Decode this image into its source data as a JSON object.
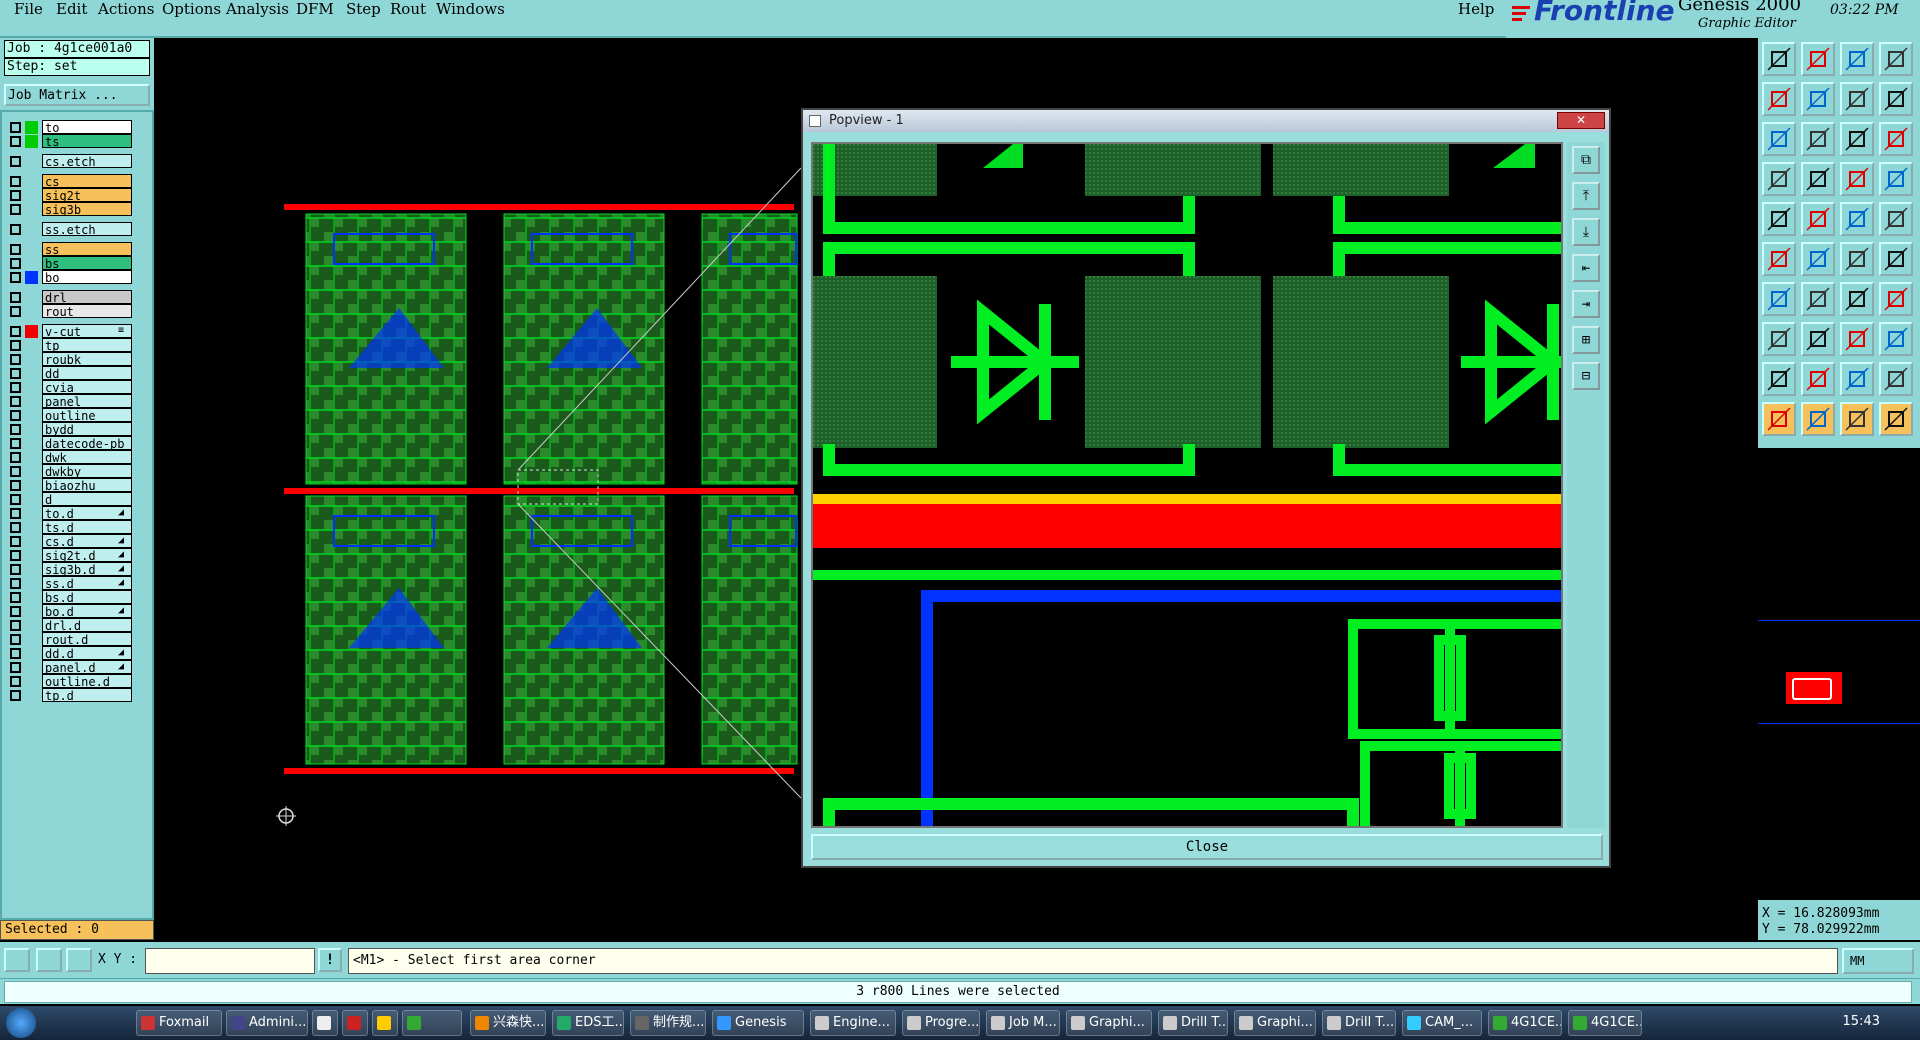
{
  "menubar": {
    "items": [
      "File",
      "Edit",
      "Actions",
      "Options",
      "Analysis",
      "DFM",
      "Step",
      "Rout",
      "Windows"
    ],
    "help": "Help"
  },
  "brand": {
    "logo": "Frontline",
    "product": "Genesis 2000",
    "subtitle": "Graphic Editor",
    "time": "03:22 PM"
  },
  "job": {
    "job_line": "Job : 4g1ce001a0",
    "step_line": "Step: set",
    "matrix_button": "Job Matrix ..."
  },
  "layers": [
    {
      "name": "to",
      "color": "#00cc00",
      "bg": "#ffffff",
      "flag": ""
    },
    {
      "name": "ts",
      "color": "#00cc00",
      "bg": "#2fbf7f",
      "flag": ""
    },
    {
      "name": "cs.etch",
      "color": "",
      "bg": "#bfeeee",
      "flag": ""
    },
    {
      "name": "cs",
      "color": "",
      "bg": "#f6c05a",
      "flag": ""
    },
    {
      "name": "sig2t",
      "color": "",
      "bg": "#f6c05a",
      "flag": ""
    },
    {
      "name": "sig3b",
      "color": "",
      "bg": "#f6c05a",
      "flag": ""
    },
    {
      "name": "ss.etch",
      "color": "",
      "bg": "#bfeeee",
      "flag": ""
    },
    {
      "name": "ss",
      "color": "",
      "bg": "#f6c05a",
      "flag": ""
    },
    {
      "name": "bs",
      "color": "",
      "bg": "#2fbf7f",
      "flag": ""
    },
    {
      "name": "bo",
      "color": "#0033ff",
      "bg": "#ffffff",
      "flag": ""
    },
    {
      "name": "drl",
      "color": "",
      "bg": "#c8c8c8",
      "flag": ""
    },
    {
      "name": "rout",
      "color": "",
      "bg": "#e8e8e8",
      "flag": ""
    },
    {
      "name": "v-cut",
      "color": "#ee0000",
      "bg": "#bfeeee",
      "flag": "≡"
    },
    {
      "name": "tp",
      "color": "",
      "bg": "#bfeeee",
      "flag": ""
    },
    {
      "name": "roubk",
      "color": "",
      "bg": "#bfeeee",
      "flag": ""
    },
    {
      "name": "dd",
      "color": "",
      "bg": "#bfeeee",
      "flag": ""
    },
    {
      "name": "cvia",
      "color": "",
      "bg": "#bfeeee",
      "flag": ""
    },
    {
      "name": "panel",
      "color": "",
      "bg": "#bfeeee",
      "flag": ""
    },
    {
      "name": "outline",
      "color": "",
      "bg": "#bfeeee",
      "flag": ""
    },
    {
      "name": "bydd",
      "color": "",
      "bg": "#bfeeee",
      "flag": ""
    },
    {
      "name": "datecode-pb",
      "color": "",
      "bg": "#bfeeee",
      "flag": ""
    },
    {
      "name": "dwk",
      "color": "",
      "bg": "#bfeeee",
      "flag": ""
    },
    {
      "name": "dwkby",
      "color": "",
      "bg": "#bfeeee",
      "flag": ""
    },
    {
      "name": "biaozhu",
      "color": "",
      "bg": "#bfeeee",
      "flag": ""
    },
    {
      "name": "d",
      "color": "",
      "bg": "#bfeeee",
      "flag": ""
    },
    {
      "name": "to.d",
      "color": "",
      "bg": "#bfeeee",
      "flag": "◢"
    },
    {
      "name": "ts.d",
      "color": "",
      "bg": "#bfeeee",
      "flag": ""
    },
    {
      "name": "cs.d",
      "color": "",
      "bg": "#bfeeee",
      "flag": "◢"
    },
    {
      "name": "sig2t.d",
      "color": "",
      "bg": "#bfeeee",
      "flag": "◢"
    },
    {
      "name": "sig3b.d",
      "color": "",
      "bg": "#bfeeee",
      "flag": "◢"
    },
    {
      "name": "ss.d",
      "color": "",
      "bg": "#bfeeee",
      "flag": "◢"
    },
    {
      "name": "bs.d",
      "color": "",
      "bg": "#bfeeee",
      "flag": ""
    },
    {
      "name": "bo.d",
      "color": "",
      "bg": "#bfeeee",
      "flag": "◢"
    },
    {
      "name": "drl.d",
      "color": "",
      "bg": "#bfeeee",
      "flag": ""
    },
    {
      "name": "rout.d",
      "color": "",
      "bg": "#bfeeee",
      "flag": ""
    },
    {
      "name": "dd.d",
      "color": "",
      "bg": "#bfeeee",
      "flag": "◢"
    },
    {
      "name": "panel.d",
      "color": "",
      "bg": "#bfeeee",
      "flag": "◢"
    },
    {
      "name": "outline.d",
      "color": "",
      "bg": "#bfeeee",
      "flag": ""
    },
    {
      "name": "tp.d",
      "color": "",
      "bg": "#bfeeee",
      "flag": ""
    }
  ],
  "selected": "Selected : 0",
  "popview": {
    "title": "Popview - 1",
    "close_label": "Close"
  },
  "coords": {
    "x": "X = 16.828093mm",
    "y": "Y = 78.029922mm"
  },
  "command": {
    "xy_label": "X Y :",
    "xy_value": "",
    "message": "<M1> - Select first area corner",
    "units": "MM"
  },
  "status": "3 r800 Lines were selected",
  "taskbar": {
    "items": [
      "Foxmail",
      "Admini...",
      "",
      "",
      "",
      "",
      "兴森快...",
      "EDS工...",
      "制作规...",
      "Genesis",
      "Engine...",
      "Progre...",
      "Job M...",
      "Graphi...",
      "Drill T...",
      "Graphi...",
      "Drill T...",
      "CAM_...",
      "4G1CE...",
      "4G1CE..."
    ],
    "clock": "15:43"
  },
  "colors": {
    "panel_bg": "#8fd7d6",
    "copper_green": "#00dd22",
    "vcut_red": "#ff0000",
    "silk_blue": "#0033ff"
  }
}
